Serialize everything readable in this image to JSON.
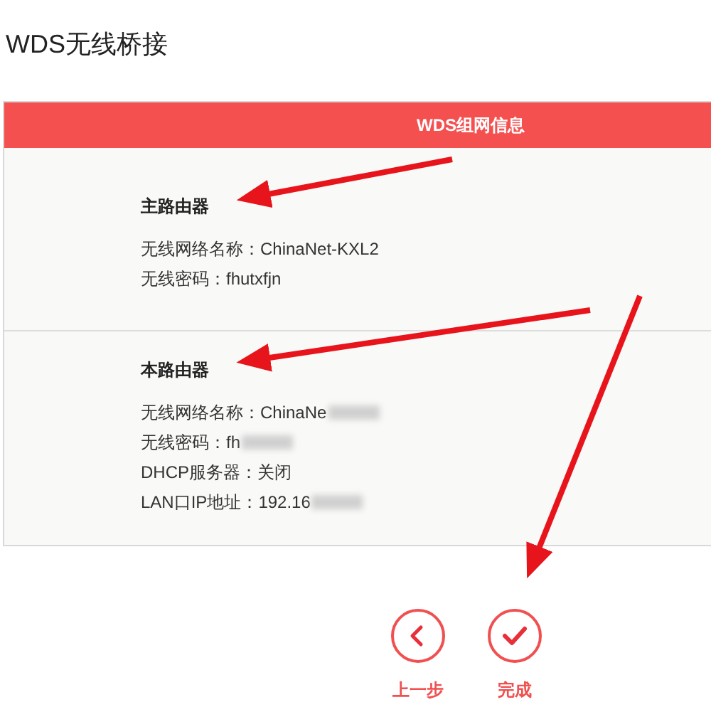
{
  "page_title": "WDS无线桥接",
  "panel": {
    "header": "WDS组网信息",
    "sections": [
      {
        "heading": "主路由器",
        "rows": [
          {
            "label": "无线网络名称：",
            "value": "ChinaNet-KXL2",
            "redacted": false
          },
          {
            "label": "无线密码：",
            "value": "fhutxfjn",
            "redacted": false
          }
        ]
      },
      {
        "heading": "本路由器",
        "rows": [
          {
            "label": "无线网络名称：",
            "value": "ChinaNe",
            "redacted": true
          },
          {
            "label": "无线密码：",
            "value": "fh",
            "redacted": true
          },
          {
            "label": "DHCP服务器：",
            "value": "关闭",
            "redacted": false
          },
          {
            "label": "LAN口IP地址：",
            "value": "192.16",
            "redacted": true
          }
        ]
      }
    ]
  },
  "buttons": [
    {
      "kind": "back",
      "label": "上一步"
    },
    {
      "kind": "finish",
      "label": "完成"
    }
  ]
}
